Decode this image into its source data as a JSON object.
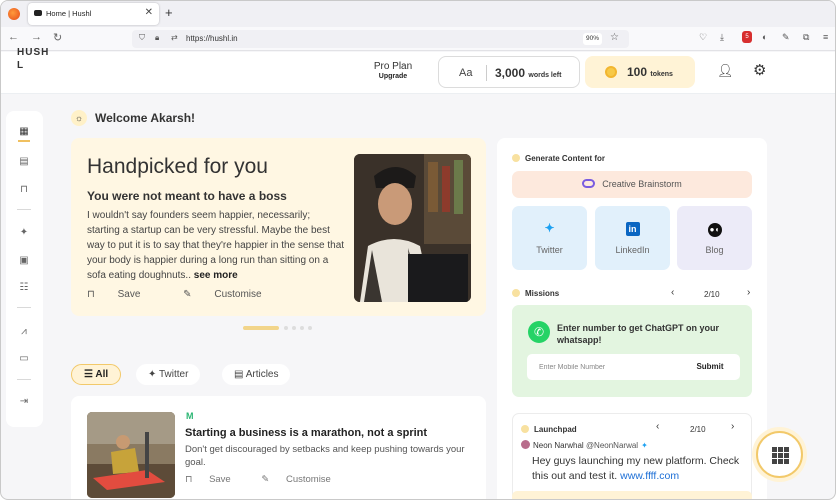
{
  "browser": {
    "tab_title": "Home | Hushl",
    "tab_close": "✕",
    "new_tab": "+",
    "url": "https://hushl.in",
    "zoom": "90%",
    "ext_badge": "5"
  },
  "header": {
    "brand": "HUSH L",
    "plan_title": "Pro Plan",
    "plan_link": "Upgrade",
    "words_icon": "Aa",
    "words_count": "3,000",
    "words_label": "words left",
    "tokens_count": "100",
    "tokens_label": "tokens"
  },
  "welcome": "Welcome Akarsh!",
  "handpicked": {
    "title": "Handpicked for you",
    "subtitle": "You were not meant to have a boss",
    "body": "I wouldn't say founders seem happier, necessarily; starting a startup can be very stressful. Maybe the best way to put it is to say that they're happier in the sense that your body is happier during a long run than sitting on a sofa eating doughnuts..",
    "see_more": "see more",
    "save": "Save",
    "customise": "Customise"
  },
  "filters": [
    {
      "label": "All"
    },
    {
      "label": "Twitter"
    },
    {
      "label": "Articles"
    }
  ],
  "article": {
    "source_icon": "M",
    "title": "Starting a business is a marathon, not a sprint",
    "body": "Don't get discouraged by setbacks and keep pushing towards your goal.",
    "save": "Save",
    "customise": "Customise"
  },
  "generate": {
    "label": "Generate Content for",
    "brainstorm": "Creative Brainstorm",
    "platforms": [
      {
        "label": "Twitter",
        "icon": "twitter-icon"
      },
      {
        "label": "LinkedIn",
        "icon": "linkedin-icon"
      },
      {
        "label": "Blog",
        "icon": "blog-icon"
      }
    ]
  },
  "missions": {
    "label": "Missions",
    "pager": "2/10",
    "whatsapp_text": "Enter number to get ChatGPT on your whatsapp!",
    "input_placeholder": "Enter Mobile Number",
    "submit": "Submit"
  },
  "launchpad": {
    "label": "Launchpad",
    "pager": "2/10",
    "author": "Neon Narwhal",
    "handle": "@NeonNarwal",
    "body": "Hey guys launching my new platform. Check this out and test it.",
    "link": "www.ffff.com"
  },
  "colors": {
    "accent": "#f2c96a",
    "card_yellow": "#fff7e3",
    "twitter_blue": "#1da1f2",
    "whatsapp_green": "#25d366"
  }
}
